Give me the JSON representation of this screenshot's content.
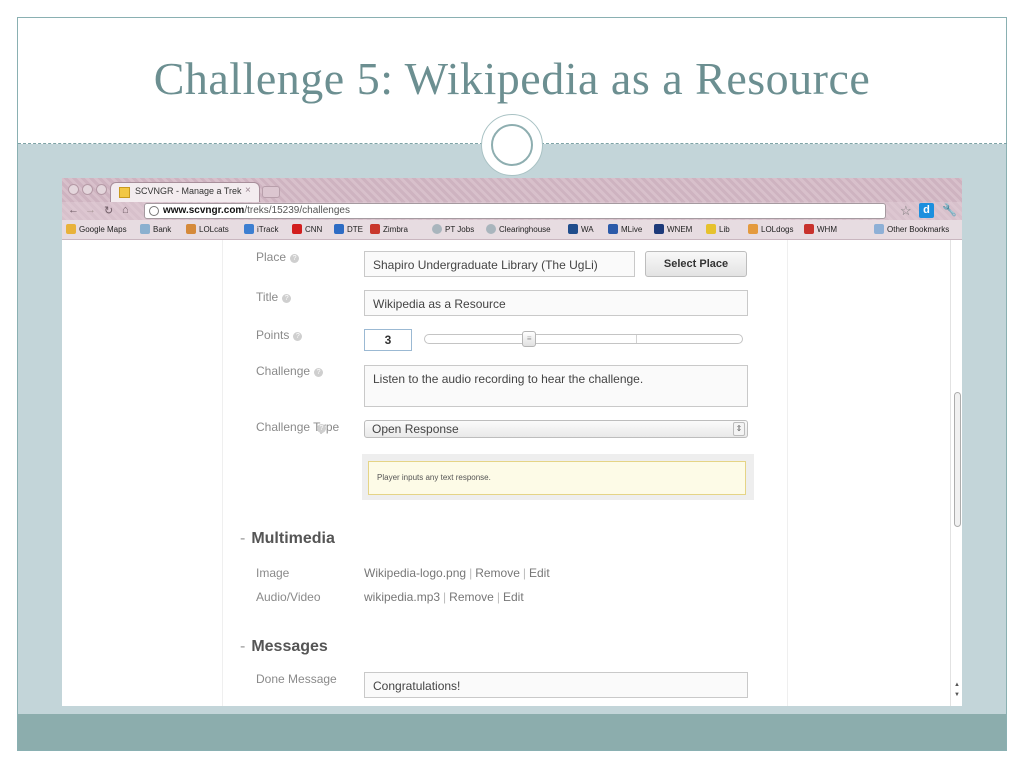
{
  "slide": {
    "title": "Challenge 5: Wikipedia as a Resource"
  },
  "browser": {
    "tab_title": "SCVNGR - Manage a Trek",
    "url_host": "www.scvngr.com",
    "url_path": "/treks/15239/challenges",
    "bookmarks": [
      {
        "label": "Google Maps",
        "icon": "maps-icon",
        "color": "#e8b23a"
      },
      {
        "label": "Bank",
        "icon": "bank-icon",
        "color": "#8ab0cf"
      },
      {
        "label": "LOLcats",
        "icon": "cat-icon",
        "color": "#d58a3a"
      },
      {
        "label": "iTrack",
        "icon": "itrack-icon",
        "color": "#3d7fd1"
      },
      {
        "label": "CNN",
        "icon": "cnn-icon",
        "color": "#d21e1e"
      },
      {
        "label": "DTE",
        "icon": "dte-icon",
        "color": "#2d6cc4"
      },
      {
        "label": "Zimbra",
        "icon": "zimbra-icon",
        "color": "#c9372c"
      },
      {
        "label": "PT Jobs",
        "icon": "globe-icon",
        "color": "#a9b5bd"
      },
      {
        "label": "Clearinghouse",
        "icon": "globe-icon",
        "color": "#a9b5bd"
      },
      {
        "label": "WA",
        "icon": "wa-icon",
        "color": "#1f4d8c"
      },
      {
        "label": "MLive",
        "icon": "mlive-icon",
        "color": "#2b5aa9"
      },
      {
        "label": "WNEM",
        "icon": "wnem-icon",
        "color": "#1d3a7a"
      },
      {
        "label": "Lib",
        "icon": "lib-icon",
        "color": "#e6c22d"
      },
      {
        "label": "LOLdogs",
        "icon": "dog-icon",
        "color": "#e49a3d"
      },
      {
        "label": "WHM",
        "icon": "whm-icon",
        "color": "#c8322d"
      }
    ],
    "other_bookmarks": "Other Bookmarks"
  },
  "form": {
    "place_label": "Place",
    "place_value": "Shapiro Undergraduate Library (The UgLi)",
    "select_place_button": "Select Place",
    "title_label": "Title",
    "title_value": "Wikipedia as a Resource",
    "points_label": "Points",
    "points_value": "3",
    "points_level": 0.33,
    "challenge_label": "Challenge",
    "challenge_value": "Listen to the audio recording to hear the challenge.",
    "challenge_type_label": "Challenge Type",
    "challenge_type_value": "Open Response",
    "challenge_type_hint": "Player inputs any text response."
  },
  "multimedia": {
    "heading": "Multimedia",
    "image_label": "Image",
    "image_file": "Wikipedia-logo.png",
    "audio_label": "Audio/Video",
    "audio_file": "wikipedia.mp3",
    "remove": "Remove",
    "edit": "Edit"
  },
  "messages": {
    "heading": "Messages",
    "done_label": "Done Message",
    "done_value": "Congratulations!"
  }
}
